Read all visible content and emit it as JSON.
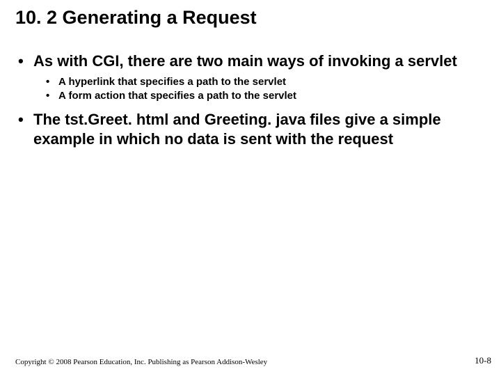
{
  "slide": {
    "title": "10. 2 Generating a Request",
    "bullets": [
      {
        "text": "As with CGI, there are two main ways of invoking a servlet",
        "sub": [
          "A hyperlink that specifies a path to the servlet",
          "A form action that specifies a path to the servlet"
        ]
      },
      {
        "text": "The tst.Greet. html and Greeting. java files give a simple example in which no data is sent with the request",
        "sub": []
      }
    ],
    "footer": {
      "copyright": "Copyright © 2008 Pearson Education, Inc. Publishing as Pearson Addison-Wesley",
      "page": "10-8"
    }
  }
}
